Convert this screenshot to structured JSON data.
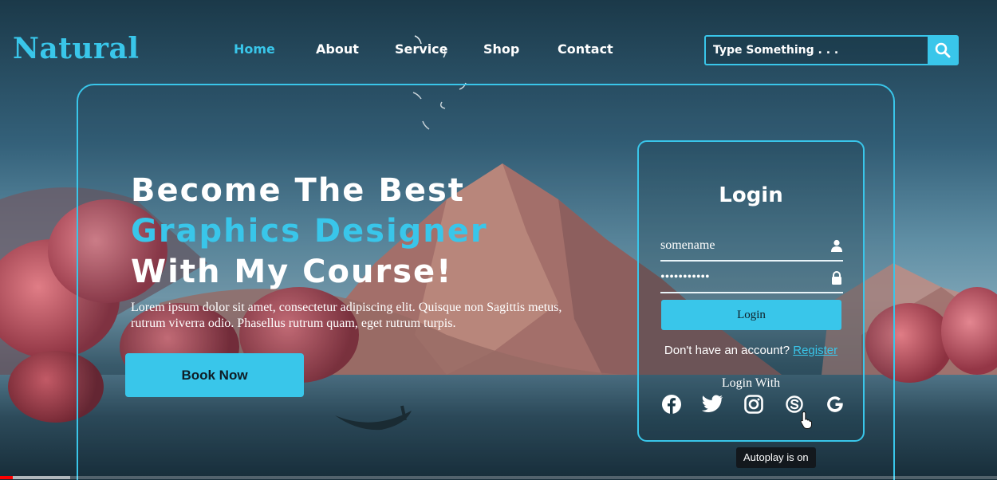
{
  "brand": {
    "logo_text": "Natural"
  },
  "nav": {
    "items": [
      {
        "label": "Home",
        "active": true
      },
      {
        "label": "About",
        "active": false
      },
      {
        "label": "Service",
        "active": false
      },
      {
        "label": "Shop",
        "active": false
      },
      {
        "label": "Contact",
        "active": false
      }
    ]
  },
  "search": {
    "placeholder": "Type Something . . .",
    "icon": "search-icon"
  },
  "hero": {
    "headline_line1": "Become The Best",
    "headline_line2": "Graphics Designer",
    "headline_line3": "With My Course!",
    "description": "Lorem ipsum dolor sit amet, consectetur adipiscing elit. Quisque non Sagittis metus, rutrum viverra odio. Phasellus rutrum quam, eget rutrum turpis.",
    "cta_label": "Book Now"
  },
  "login": {
    "title": "Login",
    "username_value": "somename",
    "username_icon": "user-icon",
    "password_value": "•••••••••••",
    "password_icon": "lock-icon",
    "submit_label": "Login",
    "register_prompt": "Don't have an account?",
    "register_link": "Register",
    "login_with_label": "Login With",
    "socials": [
      "facebook-icon",
      "twitter-icon",
      "instagram-icon",
      "skype-icon",
      "google-icon"
    ]
  },
  "player": {
    "autoplay_toast": "Autoplay is on",
    "played_fraction": 0.013,
    "buffered_fraction": 0.07
  },
  "colors": {
    "accent": "#39c6ea",
    "text": "#ffffff",
    "progress_played": "#ff0000"
  }
}
